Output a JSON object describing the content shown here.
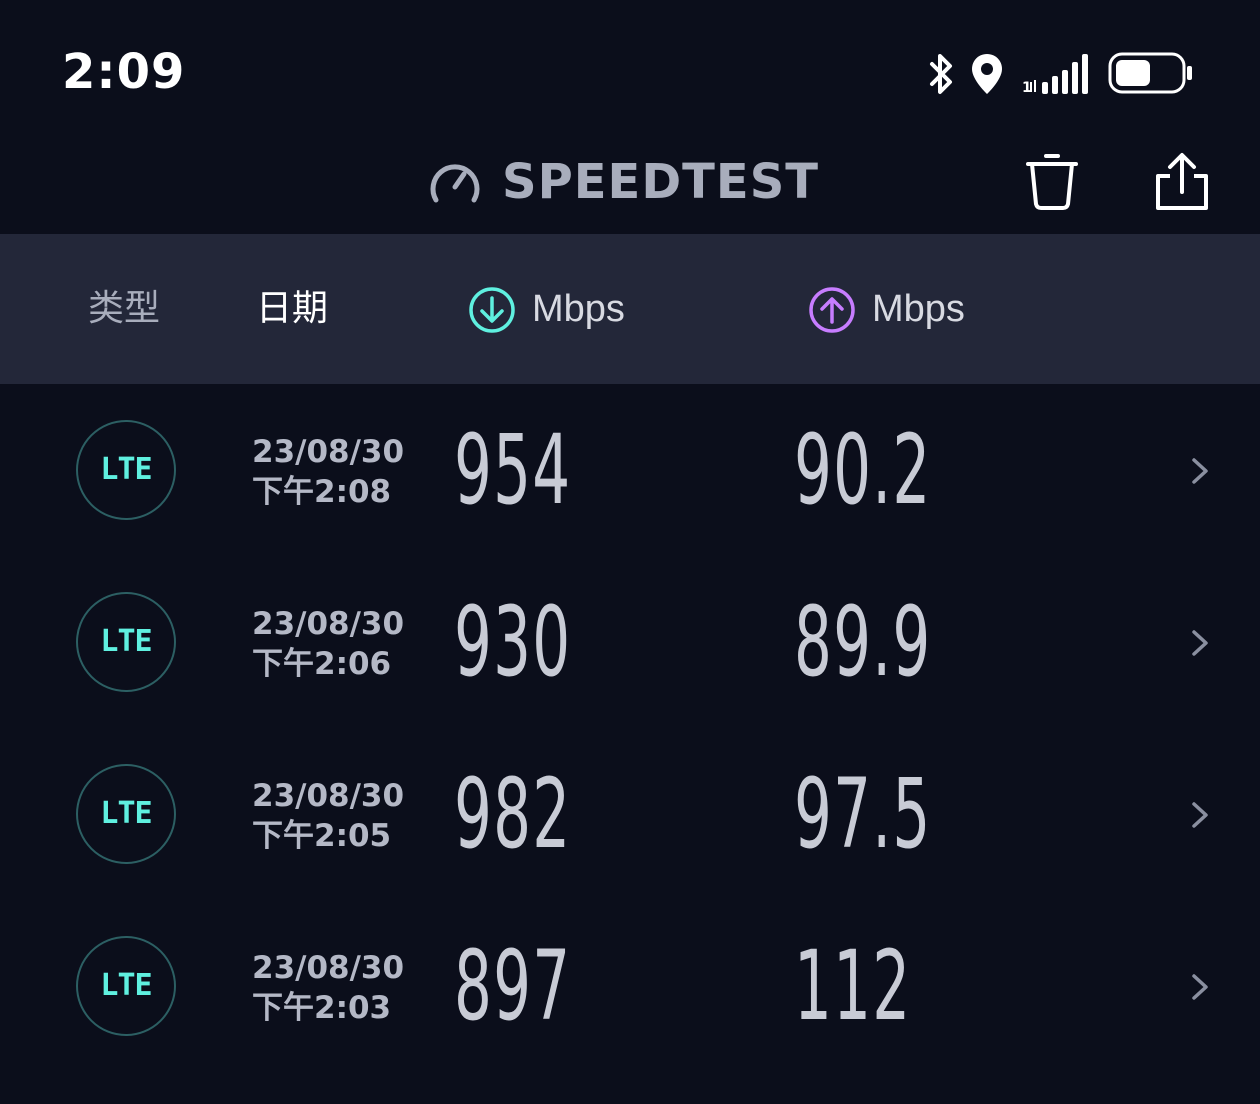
{
  "status_bar": {
    "time": "2:09",
    "icons": [
      "bluetooth-icon",
      "location-icon",
      "cellular-signal-icon",
      "battery-icon"
    ]
  },
  "header": {
    "title": "SPEEDTEST",
    "logo_icon": "speedometer-icon",
    "actions": [
      "trash-icon",
      "share-icon"
    ]
  },
  "columns": {
    "type": "类型",
    "date": "日期",
    "download_unit": "Mbps",
    "upload_unit": "Mbps",
    "download_color": "#5ff0e0",
    "upload_color": "#c77dff"
  },
  "results": [
    {
      "type": "LTE",
      "date": "23/08/30",
      "time": "下午2:08",
      "download": "954",
      "upload": "90.2"
    },
    {
      "type": "LTE",
      "date": "23/08/30",
      "time": "下午2:06",
      "download": "930",
      "upload": "89.9"
    },
    {
      "type": "LTE",
      "date": "23/08/30",
      "time": "下午2:05",
      "download": "982",
      "upload": "97.5"
    },
    {
      "type": "LTE",
      "date": "23/08/30",
      "time": "下午2:03",
      "download": "897",
      "upload": "112"
    }
  ],
  "colors": {
    "background": "#0b0e1b",
    "header_bar": "#232739",
    "accent_lte": "#5ff0e0"
  }
}
